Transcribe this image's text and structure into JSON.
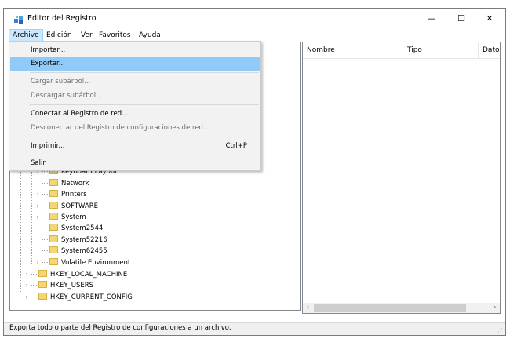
{
  "window": {
    "title": "Editor del Registro",
    "controls": {
      "minimize": "—",
      "maximize": "☐",
      "close": "✕"
    }
  },
  "menubar": {
    "items": [
      "Archivo",
      "Edición",
      "Ver",
      "Favoritos",
      "Ayuda"
    ],
    "active": "Archivo"
  },
  "file_menu": {
    "importar": "Importar...",
    "exportar": "Exportar...",
    "cargar": "Cargar subárbol...",
    "descargar": "Descargar subárbol...",
    "conectar": "Conectar al Registro de red...",
    "desconectar": "Desconectar del Registro de configuraciones de red...",
    "imprimir": "Imprimir...",
    "imprimir_shortcut": "Ctrl+P",
    "salir": "Salir"
  },
  "tree": {
    "children": [
      "Keyboard Layout",
      "Network",
      "Printers",
      "SOFTWARE",
      "System",
      "System2544",
      "System52216",
      "System62455",
      "Volatile Environment"
    ],
    "roots": [
      "HKEY_LOCAL_MACHINE",
      "HKEY_USERS",
      "HKEY_CURRENT_CONFIG"
    ]
  },
  "list": {
    "columns": [
      "Nombre",
      "Tipo",
      "Dato"
    ]
  },
  "status": {
    "text": "Exporta todo o parte del Registro de configuraciones a un archivo."
  },
  "colors": {
    "menu_highlight": "#91c9f7",
    "active_menu": "#cce8ff",
    "folder": "#f4d675"
  }
}
